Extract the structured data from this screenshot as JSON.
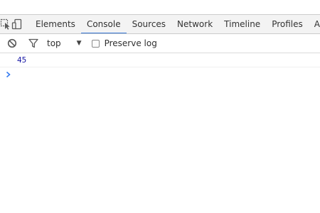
{
  "toolbar": {
    "inspect_icon": "inspect-element-icon",
    "device_icon": "device-mode-icon",
    "tabs": [
      {
        "label": "Elements",
        "active": false
      },
      {
        "label": "Console",
        "active": true
      },
      {
        "label": "Sources",
        "active": false
      },
      {
        "label": "Network",
        "active": false
      },
      {
        "label": "Timeline",
        "active": false
      },
      {
        "label": "Profiles",
        "active": false
      },
      {
        "label": "Ap",
        "active": false
      }
    ],
    "accent_color": "#3879d9"
  },
  "console_toolbar": {
    "clear_icon": "clear-console-icon",
    "filter_icon": "filter-icon",
    "context_value": "top",
    "preserve_log_label": "Preserve log",
    "preserve_log_checked": false
  },
  "console": {
    "messages": [
      {
        "text": "45",
        "color": "#1a1aa6"
      }
    ],
    "prompt_glyph_color": "#367cf1"
  }
}
